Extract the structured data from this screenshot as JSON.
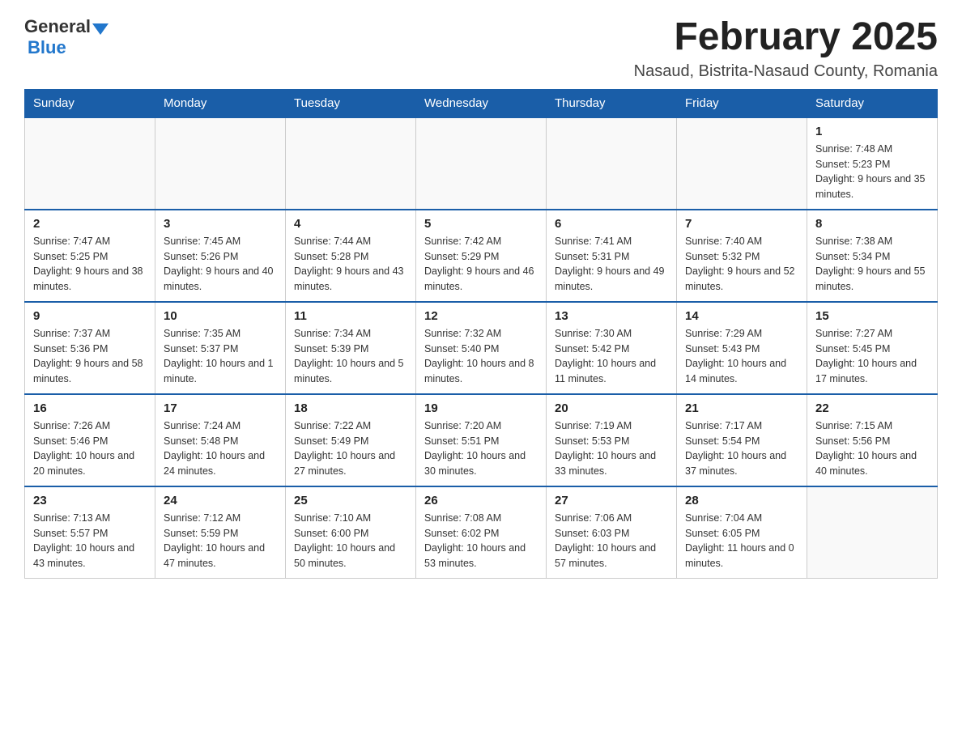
{
  "logo": {
    "general": "General",
    "blue": "Blue"
  },
  "title": "February 2025",
  "subtitle": "Nasaud, Bistrita-Nasaud County, Romania",
  "weekdays": [
    "Sunday",
    "Monday",
    "Tuesday",
    "Wednesday",
    "Thursday",
    "Friday",
    "Saturday"
  ],
  "weeks": [
    [
      {
        "day": "",
        "info": ""
      },
      {
        "day": "",
        "info": ""
      },
      {
        "day": "",
        "info": ""
      },
      {
        "day": "",
        "info": ""
      },
      {
        "day": "",
        "info": ""
      },
      {
        "day": "",
        "info": ""
      },
      {
        "day": "1",
        "info": "Sunrise: 7:48 AM\nSunset: 5:23 PM\nDaylight: 9 hours and 35 minutes."
      }
    ],
    [
      {
        "day": "2",
        "info": "Sunrise: 7:47 AM\nSunset: 5:25 PM\nDaylight: 9 hours and 38 minutes."
      },
      {
        "day": "3",
        "info": "Sunrise: 7:45 AM\nSunset: 5:26 PM\nDaylight: 9 hours and 40 minutes."
      },
      {
        "day": "4",
        "info": "Sunrise: 7:44 AM\nSunset: 5:28 PM\nDaylight: 9 hours and 43 minutes."
      },
      {
        "day": "5",
        "info": "Sunrise: 7:42 AM\nSunset: 5:29 PM\nDaylight: 9 hours and 46 minutes."
      },
      {
        "day": "6",
        "info": "Sunrise: 7:41 AM\nSunset: 5:31 PM\nDaylight: 9 hours and 49 minutes."
      },
      {
        "day": "7",
        "info": "Sunrise: 7:40 AM\nSunset: 5:32 PM\nDaylight: 9 hours and 52 minutes."
      },
      {
        "day": "8",
        "info": "Sunrise: 7:38 AM\nSunset: 5:34 PM\nDaylight: 9 hours and 55 minutes."
      }
    ],
    [
      {
        "day": "9",
        "info": "Sunrise: 7:37 AM\nSunset: 5:36 PM\nDaylight: 9 hours and 58 minutes."
      },
      {
        "day": "10",
        "info": "Sunrise: 7:35 AM\nSunset: 5:37 PM\nDaylight: 10 hours and 1 minute."
      },
      {
        "day": "11",
        "info": "Sunrise: 7:34 AM\nSunset: 5:39 PM\nDaylight: 10 hours and 5 minutes."
      },
      {
        "day": "12",
        "info": "Sunrise: 7:32 AM\nSunset: 5:40 PM\nDaylight: 10 hours and 8 minutes."
      },
      {
        "day": "13",
        "info": "Sunrise: 7:30 AM\nSunset: 5:42 PM\nDaylight: 10 hours and 11 minutes."
      },
      {
        "day": "14",
        "info": "Sunrise: 7:29 AM\nSunset: 5:43 PM\nDaylight: 10 hours and 14 minutes."
      },
      {
        "day": "15",
        "info": "Sunrise: 7:27 AM\nSunset: 5:45 PM\nDaylight: 10 hours and 17 minutes."
      }
    ],
    [
      {
        "day": "16",
        "info": "Sunrise: 7:26 AM\nSunset: 5:46 PM\nDaylight: 10 hours and 20 minutes."
      },
      {
        "day": "17",
        "info": "Sunrise: 7:24 AM\nSunset: 5:48 PM\nDaylight: 10 hours and 24 minutes."
      },
      {
        "day": "18",
        "info": "Sunrise: 7:22 AM\nSunset: 5:49 PM\nDaylight: 10 hours and 27 minutes."
      },
      {
        "day": "19",
        "info": "Sunrise: 7:20 AM\nSunset: 5:51 PM\nDaylight: 10 hours and 30 minutes."
      },
      {
        "day": "20",
        "info": "Sunrise: 7:19 AM\nSunset: 5:53 PM\nDaylight: 10 hours and 33 minutes."
      },
      {
        "day": "21",
        "info": "Sunrise: 7:17 AM\nSunset: 5:54 PM\nDaylight: 10 hours and 37 minutes."
      },
      {
        "day": "22",
        "info": "Sunrise: 7:15 AM\nSunset: 5:56 PM\nDaylight: 10 hours and 40 minutes."
      }
    ],
    [
      {
        "day": "23",
        "info": "Sunrise: 7:13 AM\nSunset: 5:57 PM\nDaylight: 10 hours and 43 minutes."
      },
      {
        "day": "24",
        "info": "Sunrise: 7:12 AM\nSunset: 5:59 PM\nDaylight: 10 hours and 47 minutes."
      },
      {
        "day": "25",
        "info": "Sunrise: 7:10 AM\nSunset: 6:00 PM\nDaylight: 10 hours and 50 minutes."
      },
      {
        "day": "26",
        "info": "Sunrise: 7:08 AM\nSunset: 6:02 PM\nDaylight: 10 hours and 53 minutes."
      },
      {
        "day": "27",
        "info": "Sunrise: 7:06 AM\nSunset: 6:03 PM\nDaylight: 10 hours and 57 minutes."
      },
      {
        "day": "28",
        "info": "Sunrise: 7:04 AM\nSunset: 6:05 PM\nDaylight: 11 hours and 0 minutes."
      },
      {
        "day": "",
        "info": ""
      }
    ]
  ]
}
